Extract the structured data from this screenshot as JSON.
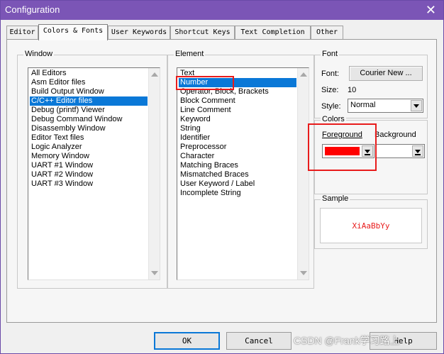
{
  "window": {
    "title": "Configuration"
  },
  "tabs": [
    "Editor",
    "Colors & Fonts",
    "User Keywords",
    "Shortcut Keys",
    "Text Completion",
    "Other"
  ],
  "window_group": {
    "label": "Window",
    "items": [
      "All Editors",
      "Asm Editor files",
      "Build Output Window",
      "C/C++ Editor files",
      "Debug (printf) Viewer",
      "Debug Command Window",
      "Disassembly Window",
      "Editor Text files",
      "Logic Analyzer",
      "Memory Window",
      "UART #1 Window",
      "UART #2 Window",
      "UART #3 Window"
    ],
    "selected": "C/C++ Editor files"
  },
  "element_group": {
    "label": "Element",
    "items": [
      "Text",
      "Number",
      "Operator, Block, Brackets",
      "Block Comment",
      "Line Comment",
      "Keyword",
      "String",
      "Identifier",
      "Preprocessor",
      "Character",
      "Matching Braces",
      "Mismatched Braces",
      "User Keyword / Label",
      "Incomplete String"
    ],
    "selected": "Number"
  },
  "font_group": {
    "label": "Font",
    "font_label": "Font:",
    "font_button": "Courier New ...",
    "size_label": "Size:",
    "size_value": "10",
    "style_label": "Style:",
    "style_value": "Normal"
  },
  "colors_group": {
    "label": "Colors",
    "foreground_label": "Foreground",
    "background_label": "Background",
    "foreground_color": "#ff0000",
    "background_color": "#ffffff"
  },
  "sample_group": {
    "label": "Sample",
    "text": "XiAaBbYy",
    "text_color": "#e81c1c"
  },
  "buttons": {
    "ok": "OK",
    "cancel": "Cancel",
    "help": "Help"
  },
  "watermark": "CSDN @Frank学习路上",
  "icons": {
    "close": "close-icon",
    "scroll_up": "scroll-up-arrow-icon",
    "scroll_down": "scroll-down-arrow-icon",
    "dropdown": "dropdown-arrow-icon"
  }
}
